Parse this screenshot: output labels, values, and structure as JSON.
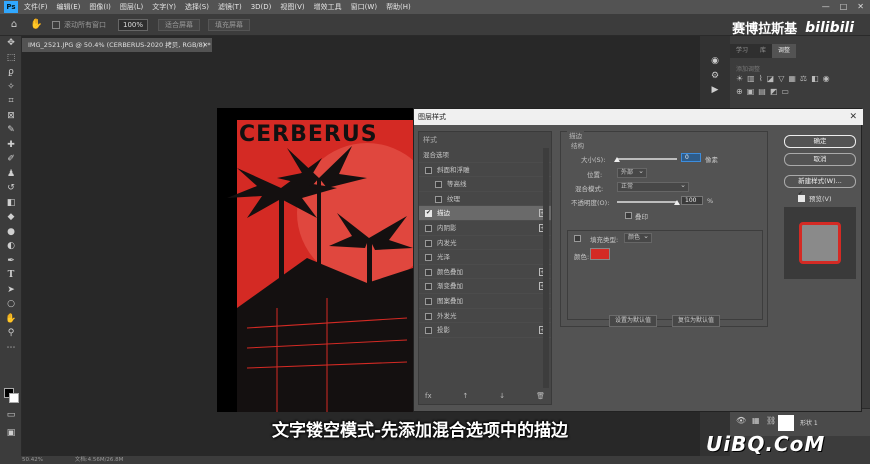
{
  "menubar": {
    "logo": "Ps",
    "items": [
      "文件(F)",
      "编辑(E)",
      "图像(I)",
      "图层(L)",
      "文字(Y)",
      "选择(S)",
      "滤镜(T)",
      "3D(D)",
      "视图(V)",
      "增效工具",
      "窗口(W)",
      "帮助(H)"
    ],
    "controls": [
      "—",
      "□",
      "✕"
    ]
  },
  "optionsbar": {
    "home_icon": "home-icon",
    "hand_icon": "hand-icon",
    "scroll_all_label": "滚动所有窗口",
    "zoom_value": "100%",
    "fit_screen_label": "适合屏幕",
    "fill_screen_label": "填充屏幕"
  },
  "brand": {
    "name": "赛博拉斯基",
    "logo": "bilibili"
  },
  "document": {
    "tab_title": "IMG_2521.JPG @ 50.4% (CERBERUS-2020 拷贝, RGB/8) *",
    "close": "✕"
  },
  "canvas": {
    "poster_title": "CERBERUS"
  },
  "status": {
    "zoom": "50.42%",
    "doc_size": "文档:4.56M/26.8M"
  },
  "panel": {
    "tabs": [
      "学习",
      "库",
      "调整"
    ],
    "active_tab": "调整",
    "adjust_hint": "添加调整",
    "layer_name": "形状 1"
  },
  "dialog": {
    "title": "图层样式",
    "close": "✕",
    "styles_header": "样式",
    "items": [
      {
        "label": "混合选项",
        "check": false,
        "indent": false,
        "plus": false,
        "selected": false
      },
      {
        "label": "斜面和浮雕",
        "check": true,
        "on": false,
        "indent": false,
        "plus": false,
        "selected": false
      },
      {
        "label": "等高线",
        "check": true,
        "on": false,
        "indent": true,
        "plus": false,
        "selected": false
      },
      {
        "label": "纹理",
        "check": true,
        "on": false,
        "indent": true,
        "plus": false,
        "selected": false
      },
      {
        "label": "描边",
        "check": true,
        "on": true,
        "indent": false,
        "plus": true,
        "selected": true
      },
      {
        "label": "内阴影",
        "check": true,
        "on": false,
        "indent": false,
        "plus": true,
        "selected": false
      },
      {
        "label": "内发光",
        "check": true,
        "on": false,
        "indent": false,
        "plus": false,
        "selected": false
      },
      {
        "label": "光泽",
        "check": true,
        "on": false,
        "indent": false,
        "plus": false,
        "selected": false
      },
      {
        "label": "颜色叠加",
        "check": true,
        "on": false,
        "indent": false,
        "plus": true,
        "selected": false
      },
      {
        "label": "渐变叠加",
        "check": true,
        "on": false,
        "indent": false,
        "plus": true,
        "selected": false
      },
      {
        "label": "图案叠加",
        "check": true,
        "on": false,
        "indent": false,
        "plus": false,
        "selected": false
      },
      {
        "label": "外发光",
        "check": true,
        "on": false,
        "indent": false,
        "plus": false,
        "selected": false
      },
      {
        "label": "投影",
        "check": true,
        "on": false,
        "indent": false,
        "plus": true,
        "selected": false
      }
    ],
    "footer_icons": [
      "fx",
      "↑",
      "↓",
      "🗑"
    ],
    "stroke": {
      "section": "描边",
      "structure": "结构",
      "size_label": "大小(S):",
      "size_value": "0",
      "size_unit": "像素",
      "size_slider": 0,
      "position_label": "位置:",
      "position_value": "外部",
      "blend_label": "混合模式:",
      "blend_value": "正常",
      "opacity_label": "不透明度(O):",
      "opacity_value": "100",
      "opacity_unit": "%",
      "opacity_slider": 1.0,
      "overprint_label": "叠印",
      "fill_type_label": "填充类型:",
      "fill_type_value": "颜色",
      "color_label": "颜色:",
      "stroke_color": "#d42a24",
      "make_default": "设置为默认值",
      "reset_default": "复位为默认值"
    },
    "buttons": {
      "ok": "确定",
      "cancel": "取消",
      "new_style": "新建样式(W)...",
      "preview": "预览(V)"
    }
  },
  "subtitle": "文字镂空模式-先添加混合选项中的描边",
  "watermark": "UiBQ.CoM"
}
